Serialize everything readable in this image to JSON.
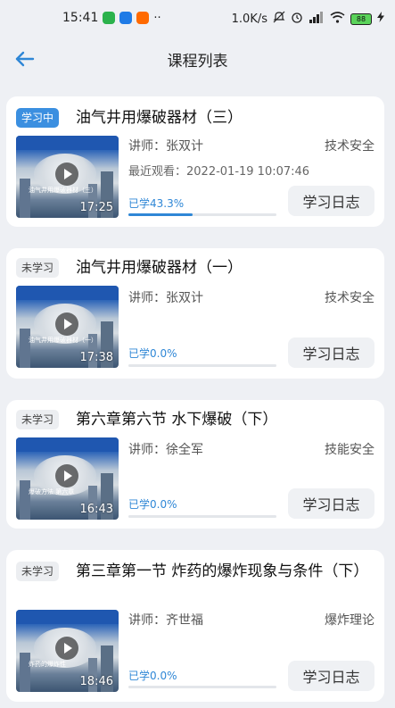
{
  "status_bar": {
    "time": "15:41",
    "speed": "1.0K/s",
    "battery": "88"
  },
  "header": {
    "title": "课程列表"
  },
  "courses": [
    {
      "status": "学习中",
      "title": "油气井用爆破器材（三）",
      "teacher": "讲师：张双计",
      "category": "技术安全",
      "last_watch": "最近观看：2022-01-19 10:07:46",
      "progress_text": "已学43.3%",
      "progress": 0.433,
      "duration": "17:25",
      "thumb_text": "油气井用爆破器材（三）",
      "log_label": "学习日志"
    },
    {
      "status": "未学习",
      "title": "油气井用爆破器材（一）",
      "teacher": "讲师：张双计",
      "category": "技术安全",
      "progress_text": "已学0.0%",
      "progress": 0.0,
      "duration": "17:38",
      "thumb_text": "油气井用爆破器材（一）",
      "log_label": "学习日志"
    },
    {
      "status": "未学习",
      "title": "第六章第六节 水下爆破（下）",
      "teacher": "讲师：徐全军",
      "category": "技能安全",
      "progress_text": "已学0.0%",
      "progress": 0.0,
      "duration": "16:43",
      "thumb_text": "爆破方法 第六章",
      "log_label": "学习日志"
    },
    {
      "status": "未学习",
      "title": "第三章第一节 炸药的爆炸现象与条件（下）",
      "teacher": "讲师：齐世福",
      "category": "爆炸理论",
      "progress_text": "已学0.0%",
      "progress": 0.0,
      "duration": "18:46",
      "thumb_text": "炸药的爆炸性",
      "log_label": "学习日志"
    }
  ],
  "colors": {
    "accent": "#2f87d6",
    "active_badge": "#3b8fe0",
    "background": "#eef0f4"
  }
}
